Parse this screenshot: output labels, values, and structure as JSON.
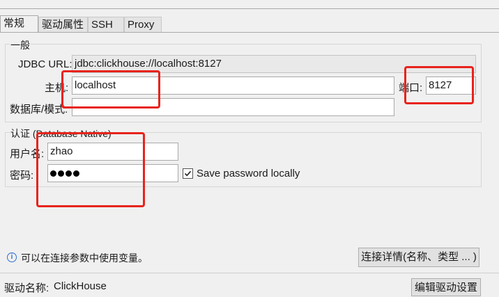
{
  "tabs": [
    {
      "label": "常规",
      "active": true
    },
    {
      "label": "驱动属性",
      "active": false
    },
    {
      "label": "SSH",
      "active": false
    },
    {
      "label": "Proxy",
      "active": false
    }
  ],
  "general": {
    "title": "一般",
    "jdbc_label": "JDBC URL:",
    "jdbc_value": "jdbc:clickhouse://localhost:8127",
    "host_label": "主机:",
    "host_value": "localhost",
    "port_label": "端口:",
    "port_value": "8127",
    "database_label": "数据库/模式:",
    "database_value": ""
  },
  "auth": {
    "title": "认证 (Database Native)",
    "username_label": "用户名:",
    "username_value": "zhao",
    "password_label": "密码:",
    "password_dots": 4,
    "save_password_label": "Save password locally",
    "save_password_checked": true
  },
  "footer": {
    "info_text": "可以在连接参数中使用变量。",
    "connection_details_button": "连接详情(名称、类型 ... )",
    "driver_label": "驱动名称:",
    "driver_value": "ClickHouse",
    "edit_driver_button": "编辑驱动设置"
  },
  "colors": {
    "annotation": "#e8231c",
    "info_icon": "#2c6fd1"
  }
}
